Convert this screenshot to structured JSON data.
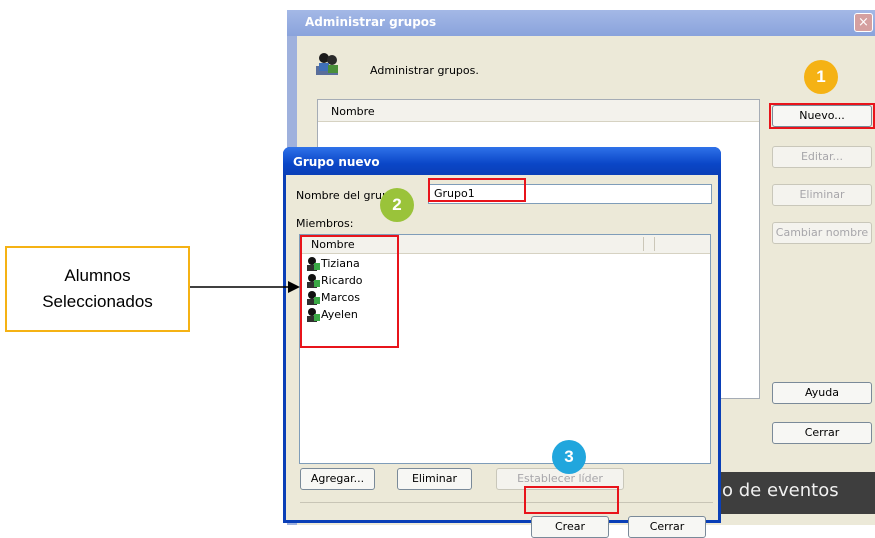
{
  "admin_window": {
    "title": "Administrar grupos",
    "close_glyph": "×",
    "header_text": "Administrar grupos.",
    "list_header": "Nombre",
    "buttons": {
      "nuevo": "Nuevo...",
      "editar": "Editar...",
      "eliminar": "Eliminar",
      "cambiar_nombre": "Cambiar nombre",
      "ayuda": "Ayuda",
      "cerrar": "Cerrar"
    },
    "background_text": "o de eventos"
  },
  "new_group_dialog": {
    "title": "Grupo nuevo",
    "name_label": "Nombre del grup",
    "name_value": "Grupo1",
    "members_label": "Miembros:",
    "members_header": "Nombre",
    "members": [
      "Tiziana",
      "Ricardo",
      "Marcos",
      "Ayelen"
    ],
    "buttons": {
      "agregar": "Agregar...",
      "eliminar": "Eliminar",
      "establecer_lider": "Establecer líder",
      "crear": "Crear",
      "cerrar": "Cerrar"
    }
  },
  "annotations": {
    "callout_line1": "Alumnos",
    "callout_line2": "Seleccionados",
    "step1": "1",
    "step2": "2",
    "step3": "3",
    "colors": {
      "highlight": "#e8141b",
      "step1": "#f5b214",
      "step2": "#9ac33a",
      "step3": "#21a6dd",
      "callout_border": "#f5b214"
    }
  }
}
